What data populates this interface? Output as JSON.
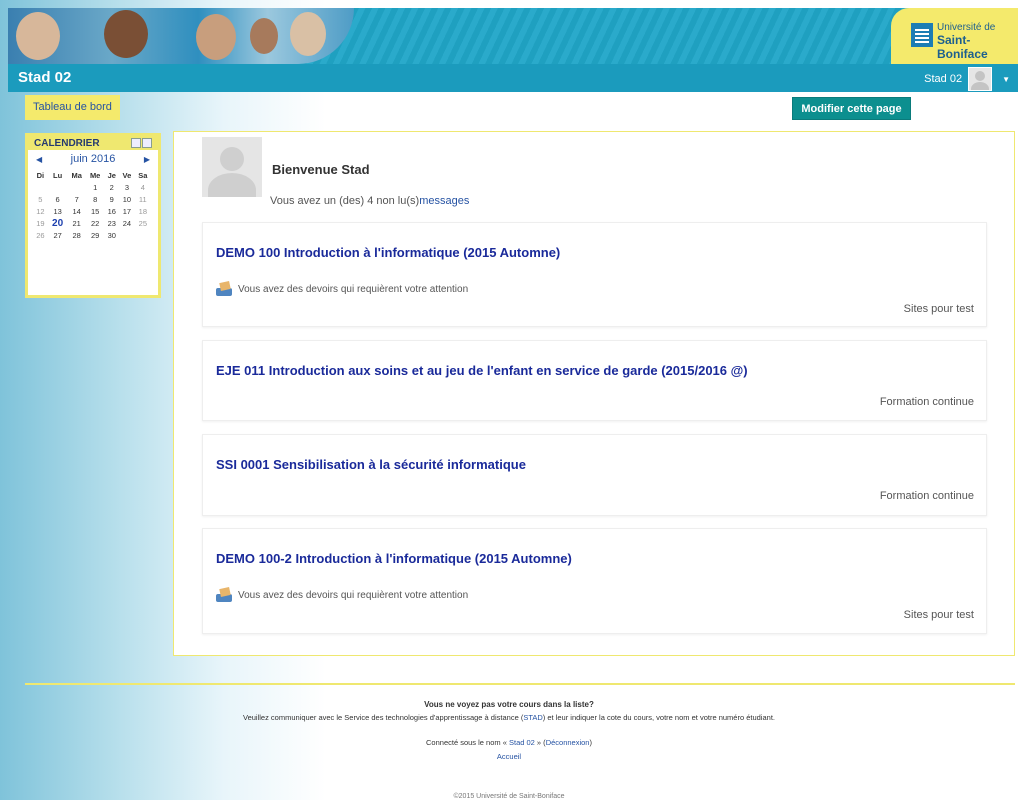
{
  "header": {
    "site_title": "Stad 02",
    "logo_line1": "Université de",
    "logo_line2": "Saint-Boniface",
    "user_name": "Stad 02"
  },
  "breadcrumb": "Tableau de bord",
  "edit_button": "Modifier cette page",
  "calendar": {
    "title": "CALENDRIER",
    "month": "juin 2016",
    "weekdays": [
      "Di",
      "Lu",
      "Ma",
      "Me",
      "Je",
      "Ve",
      "Sa"
    ],
    "weeks": [
      [
        "",
        "",
        "",
        "1",
        "2",
        "3",
        "4"
      ],
      [
        "5",
        "6",
        "7",
        "8",
        "9",
        "10",
        "11"
      ],
      [
        "12",
        "13",
        "14",
        "15",
        "16",
        "17",
        "18"
      ],
      [
        "19",
        "20",
        "21",
        "22",
        "23",
        "24",
        "25"
      ],
      [
        "26",
        "27",
        "28",
        "29",
        "30",
        "",
        ""
      ]
    ],
    "today": "20"
  },
  "welcome": {
    "title": "Bienvenue Stad",
    "msg_prefix": "Vous avez un (des) 4 non lu(s)",
    "msg_link": "messages"
  },
  "courses": [
    {
      "title": "DEMO 100 Introduction à l'informatique (2015 Automne)",
      "notice": "Vous avez des devoirs qui requièrent votre attention",
      "category": "Sites pour test"
    },
    {
      "title": "EJE 011 Introduction aux soins et au jeu de l'enfant en service de garde (2015/2016 @)",
      "notice": "",
      "category": "Formation continue"
    },
    {
      "title": "SSI 0001 Sensibilisation à la sécurité informatique",
      "notice": "",
      "category": "Formation continue"
    },
    {
      "title": "DEMO 100-2 Introduction à l'informatique (2015 Automne)",
      "notice": "Vous avez des devoirs qui requièrent votre attention",
      "category": "Sites pour test"
    }
  ],
  "footer": {
    "question": "Vous ne voyez pas votre cours dans la liste?",
    "contact_prefix": "Veuillez communiquer avec le Service des technologies d'apprentissage à distance (",
    "contact_link": "STAD",
    "contact_suffix": ") et leur indiquer la cote du cours, votre nom et votre numéro étudiant.",
    "login_prefix": "Connecté sous le nom « ",
    "login_user": "Stad 02",
    "login_mid": " » (",
    "logout": "Déconnexion",
    "login_suffix": ")",
    "home": "Accueil",
    "copyright": "©2015 Université de Saint-Boniface"
  }
}
